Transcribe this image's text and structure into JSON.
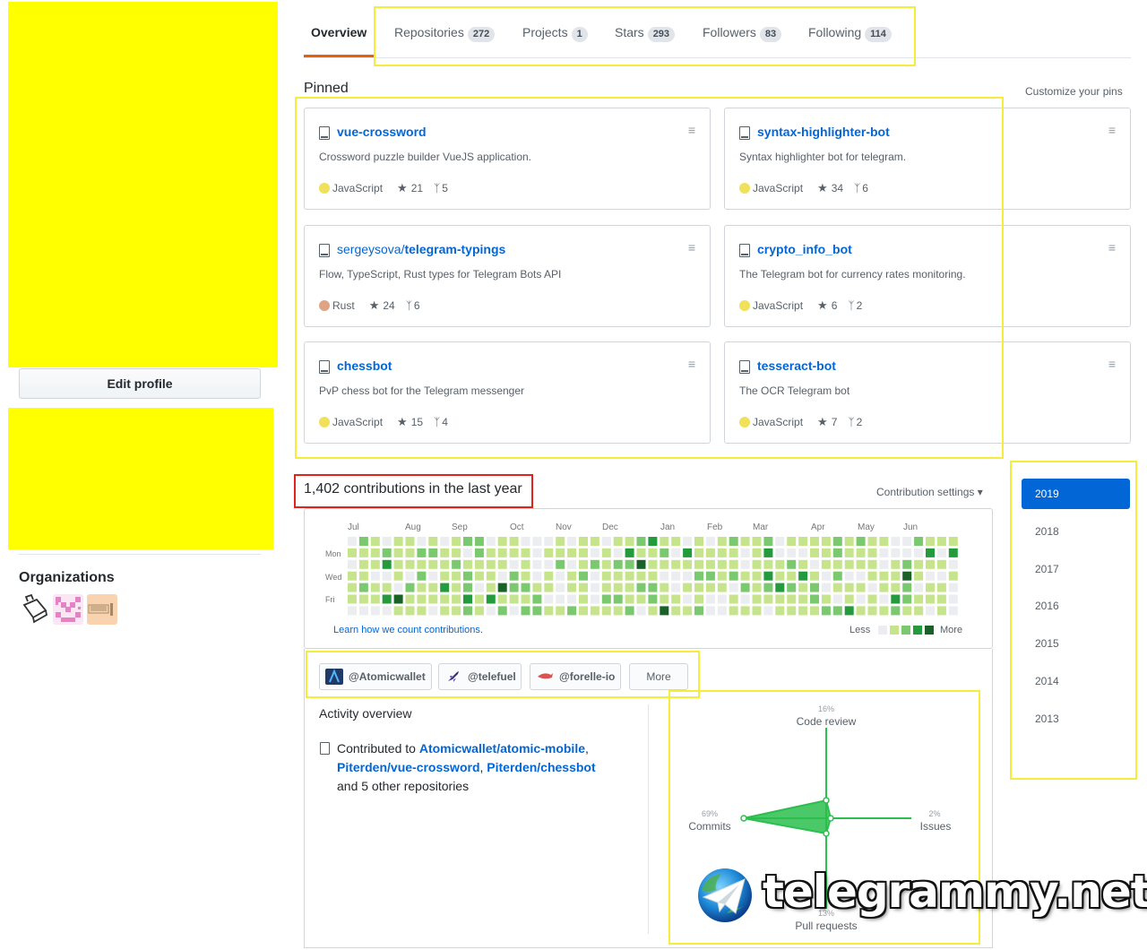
{
  "sidebar": {
    "edit_profile_label": "Edit profile",
    "organizations_title": "Organizations",
    "organizations": [
      {
        "icon": "printer-org-icon"
      },
      {
        "icon": "pink-pixel-org-icon"
      },
      {
        "icon": "peach-org-icon"
      }
    ]
  },
  "tabs": [
    {
      "label": "Overview",
      "count": ""
    },
    {
      "label": "Repositories",
      "count": "272"
    },
    {
      "label": "Projects",
      "count": "1"
    },
    {
      "label": "Stars",
      "count": "293"
    },
    {
      "label": "Followers",
      "count": "83"
    },
    {
      "label": "Following",
      "count": "114"
    }
  ],
  "pinned": {
    "title": "Pinned",
    "customize_label": "Customize your pins",
    "repos": [
      {
        "owner": "",
        "name": "vue-crossword",
        "description": "Crossword puzzle builder VueJS application.",
        "language": "JavaScript",
        "language_color": "#f1e05a",
        "stars": "21",
        "forks": "5"
      },
      {
        "owner": "",
        "name": "syntax-highlighter-bot",
        "description": "Syntax highlighter bot for telegram.",
        "language": "JavaScript",
        "language_color": "#f1e05a",
        "stars": "34",
        "forks": "6"
      },
      {
        "owner": "sergeysova/",
        "name": "telegram-typings",
        "description": "Flow, TypeScript, Rust types for Telegram Bots API",
        "language": "Rust",
        "language_color": "#dea584",
        "stars": "24",
        "forks": "6"
      },
      {
        "owner": "",
        "name": "crypto_info_bot",
        "description": "The Telegram bot for currency rates monitoring.",
        "language": "JavaScript",
        "language_color": "#f1e05a",
        "stars": "6",
        "forks": "2"
      },
      {
        "owner": "",
        "name": "chessbot",
        "description": "PvP chess bot for the Telegram messenger",
        "language": "JavaScript",
        "language_color": "#f1e05a",
        "stars": "15",
        "forks": "4"
      },
      {
        "owner": "",
        "name": "tesseract-bot",
        "description": "The OCR Telegram bot",
        "language": "JavaScript",
        "language_color": "#f1e05a",
        "stars": "7",
        "forks": "2"
      }
    ]
  },
  "contributions": {
    "title": "1,402 contributions in the last year",
    "settings_label": "Contribution settings ▾",
    "months": [
      "Jul",
      "Aug",
      "Sep",
      "Oct",
      "Nov",
      "Dec",
      "Jan",
      "Feb",
      "Mar",
      "Apr",
      "May",
      "Jun"
    ],
    "day_labels": [
      "Mon",
      "Wed",
      "Fri"
    ],
    "learn_link": "Learn how we count contributions.",
    "legend_less": "Less",
    "legend_more": "More",
    "colors": [
      "#ebedf0",
      "#c6e48b",
      "#7bc96f",
      "#239a3b",
      "#196127"
    ]
  },
  "org_filters": [
    {
      "label": "@Atomicwallet",
      "icon": "atomicwallet-icon"
    },
    {
      "label": "@telefuel",
      "icon": "rocket-icon"
    },
    {
      "label": "@forelle-io",
      "icon": "fish-icon"
    }
  ],
  "org_more_label": "More",
  "activity": {
    "title": "Activity overview",
    "prefix": "Contributed to",
    "repo1": "Atomicwallet/atomic-mobile",
    "repo2": "Piterden/vue-crossword",
    "repo3": "Piterden/chessbot",
    "suffix": "and 5 other repositories"
  },
  "radar": {
    "code_review": {
      "label": "Code review",
      "pct": "16%"
    },
    "issues": {
      "label": "Issues",
      "pct": "2%"
    },
    "pull_requests": {
      "label": "Pull requests",
      "pct": "13%"
    },
    "commits": {
      "label": "Commits",
      "pct": "69%"
    },
    "color": "#2cbe4e"
  },
  "years": [
    "2019",
    "2018",
    "2017",
    "2016",
    "2015",
    "2014",
    "2013"
  ],
  "watermark": "telegrammy.net"
}
